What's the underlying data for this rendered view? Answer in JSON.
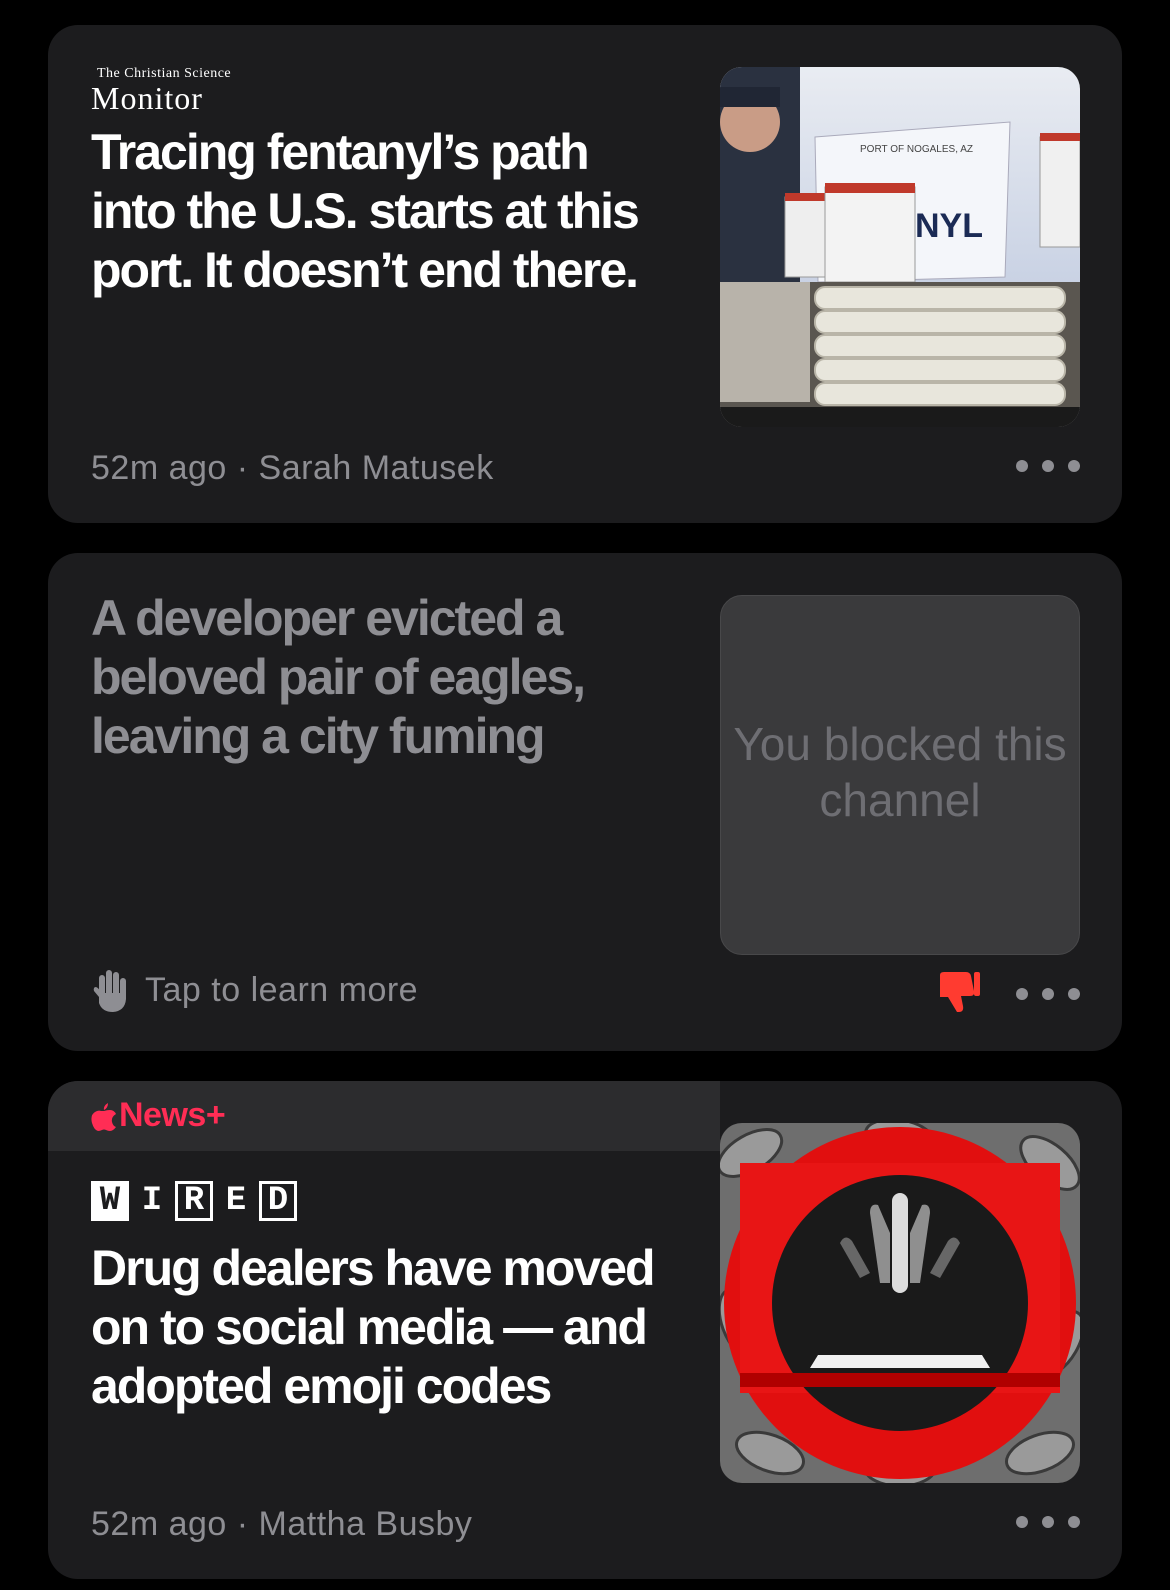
{
  "cards": [
    {
      "source": {
        "small": "The Christian Science",
        "big": "Monitor"
      },
      "headline": "Tracing fentanyl’s path into the U.S. starts at this port. It doesn’t end there.",
      "meta": "52m ago · Sarah Matusek",
      "image_signage": {
        "sign": "PORT OF NOGALES, AZ",
        "partial_word": "NYL"
      }
    },
    {
      "headline": "A developer evicted a beloved pair of eagles, leaving a city fuming",
      "blocked_text": "You blocked this channel",
      "learn_more": "Tap to learn more"
    },
    {
      "badge": "News+",
      "source": {
        "letters": [
          "W",
          "I",
          "R",
          "E",
          "D"
        ]
      },
      "headline": "Drug dealers have moved on to social media — and adopted emoji codes",
      "meta": "52m ago · Mattha Busby"
    }
  ],
  "colors": {
    "background": "#000000",
    "card": "#1c1c1e",
    "muted_text": "#8e8e93",
    "news_plus": "#ff2d55",
    "dislike": "#ff3b30"
  },
  "icons": [
    "hand-icon",
    "thumbs-down-icon",
    "more-icon",
    "apple-logo-icon"
  ]
}
